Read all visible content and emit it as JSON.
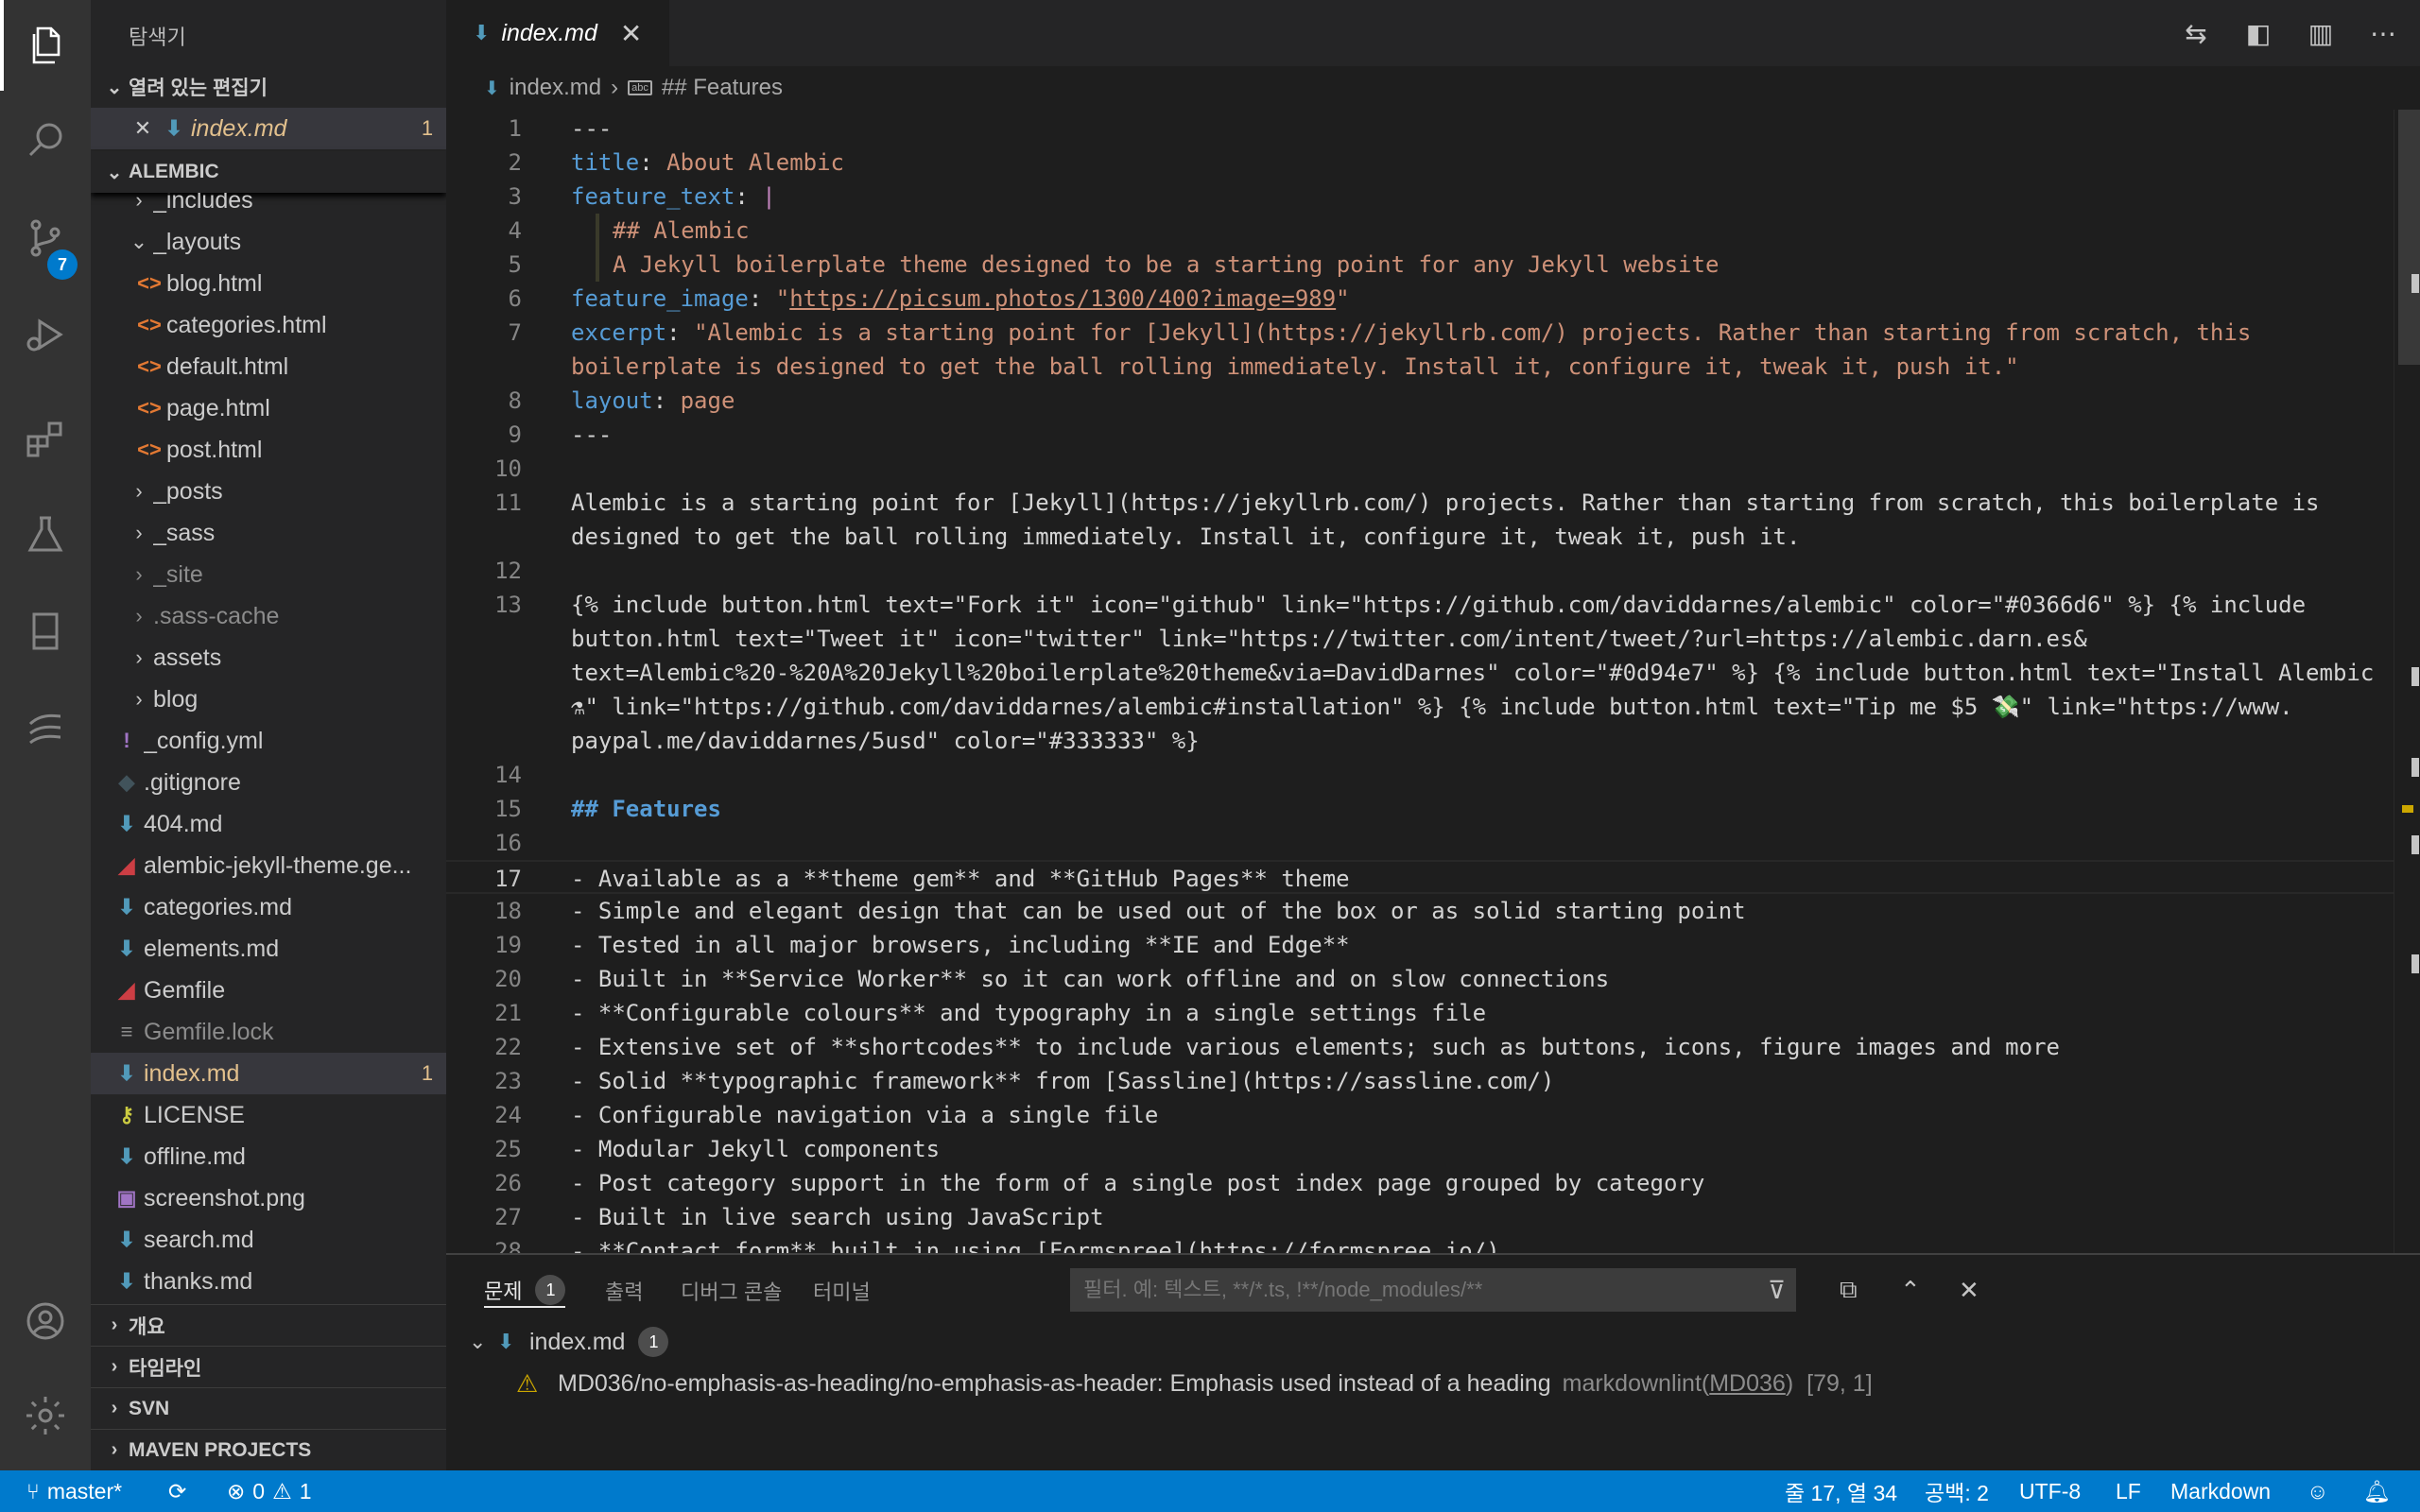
{
  "activity_bar": {
    "source_control_badge": "7"
  },
  "sidebar": {
    "title": "탐색기",
    "open_editors": {
      "header": "열려 있는 편집기",
      "items": [
        {
          "name": "index.md",
          "count": "1"
        }
      ]
    },
    "project": {
      "header": "ALEMBIC",
      "items": [
        {
          "name": "_includes"
        },
        {
          "name": "_layouts"
        },
        {
          "name": "blog.html"
        },
        {
          "name": "categories.html"
        },
        {
          "name": "default.html"
        },
        {
          "name": "page.html"
        },
        {
          "name": "post.html"
        },
        {
          "name": "_posts"
        },
        {
          "name": "_sass"
        },
        {
          "name": "_site"
        },
        {
          "name": ".sass-cache"
        },
        {
          "name": "assets"
        },
        {
          "name": "blog"
        },
        {
          "name": "_config.yml"
        },
        {
          "name": ".gitignore"
        },
        {
          "name": "404.md"
        },
        {
          "name": "alembic-jekyll-theme.ge..."
        },
        {
          "name": "categories.md"
        },
        {
          "name": "elements.md"
        },
        {
          "name": "Gemfile"
        },
        {
          "name": "Gemfile.lock"
        },
        {
          "name": "index.md",
          "count": "1"
        },
        {
          "name": "LICENSE"
        },
        {
          "name": "offline.md"
        },
        {
          "name": "screenshot.png"
        },
        {
          "name": "search.md"
        },
        {
          "name": "thanks.md"
        }
      ]
    },
    "bottom_sections": [
      "개요",
      "타임라인",
      "SVN",
      "MAVEN PROJECTS"
    ]
  },
  "editor": {
    "tab_label": "index.md",
    "breadcrumb": {
      "file": "index.md",
      "symbol": "## Features",
      "symbol_icon": "abc"
    },
    "lines": [
      {
        "n": "1",
        "t": "---"
      },
      {
        "n": "2",
        "k": "title",
        "t": "About Alembic"
      },
      {
        "n": "3",
        "k": "feature_text",
        "t": "|"
      },
      {
        "n": "4",
        "t": "## Alembic"
      },
      {
        "n": "5",
        "t": "A Jekyll boilerplate theme designed to be a starting point for any Jekyll website"
      },
      {
        "n": "6",
        "k": "feature_image",
        "t": "https://picsum.photos/1300/400?image=989"
      },
      {
        "n": "7",
        "k": "excerpt",
        "t": "\"Alembic is a starting point for [Jekyll](https://jekyllrb.com/) projects. Rather than starting from scratch, this"
      },
      {
        "n": "",
        "t": "boilerplate is designed to get the ball rolling immediately. Install it, configure it, tweak it, push it.\""
      },
      {
        "n": "8",
        "k": "layout",
        "t": "page"
      },
      {
        "n": "9",
        "t": "---"
      },
      {
        "n": "10",
        "t": ""
      },
      {
        "n": "11",
        "t": "Alembic is a starting point for [Jekyll](https://jekyllrb.com/) projects. Rather than starting from scratch, this boilerplate is"
      },
      {
        "n": "",
        "t": "designed to get the ball rolling immediately. Install it, configure it, tweak it, push it."
      },
      {
        "n": "12",
        "t": ""
      },
      {
        "n": "13",
        "t": "{% include button.html text=\"Fork it\" icon=\"github\" link=\"https://github.com/daviddarnes/alembic\" color=\"#0366d6\" %} {% include"
      },
      {
        "n": "",
        "t": "button.html text=\"Tweet it\" icon=\"twitter\" link=\"https://twitter.com/intent/tweet/?url=https://alembic.darn.es&"
      },
      {
        "n": "",
        "t": "text=Alembic%20-%20A%20Jekyll%20boilerplate%20theme&via=DavidDarnes\" color=\"#0d94e7\" %} {% include button.html text=\"Install Alembic"
      },
      {
        "n": "",
        "t": "⚗\" link=\"https://github.com/daviddarnes/alembic#installation\" %} {% include button.html text=\"Tip me $5 💸\" link=\"https://www."
      },
      {
        "n": "",
        "t": "paypal.me/daviddarnes/5usd\" color=\"#333333\" %}"
      },
      {
        "n": "14",
        "t": ""
      },
      {
        "n": "15",
        "t": "## Features"
      },
      {
        "n": "16",
        "t": ""
      },
      {
        "n": "17",
        "t": "- Available as a **theme gem** and **GitHub Pages** theme"
      },
      {
        "n": "18",
        "t": "- Simple and elegant design that can be used out of the box or as solid starting point"
      },
      {
        "n": "19",
        "t": "- Tested in all major browsers, including **IE and Edge**"
      },
      {
        "n": "20",
        "t": "- Built in **Service Worker** so it can work offline and on slow connections"
      },
      {
        "n": "21",
        "t": "- **Configurable colours** and typography in a single settings file"
      },
      {
        "n": "22",
        "t": "- Extensive set of **shortcodes** to include various elements; such as buttons, icons, figure images and more"
      },
      {
        "n": "23",
        "t": "- Solid **typographic framework** from [Sassline](https://sassline.com/)"
      },
      {
        "n": "24",
        "t": "- Configurable navigation via a single file"
      },
      {
        "n": "25",
        "t": "- Modular Jekyll components"
      },
      {
        "n": "26",
        "t": "- Post category support in the form of a single post index page grouped by category"
      },
      {
        "n": "27",
        "t": "- Built in live search using JavaScript"
      },
      {
        "n": "28",
        "t": "- **Contact form** built in using [Formspree](https://formspree.io/)"
      }
    ]
  },
  "panel": {
    "tabs": [
      {
        "label": "문제",
        "badge": "1"
      },
      {
        "label": "출력"
      },
      {
        "label": "디버그 콘솔"
      },
      {
        "label": "터미널"
      }
    ],
    "filter_placeholder": "필터. 예: 텍스트, **/*.ts, !**/node_modules/**",
    "file": {
      "name": "index.md",
      "count": "1"
    },
    "problem": {
      "message": "MD036/no-emphasis-as-heading/no-emphasis-as-header: Emphasis used instead of a heading",
      "source": "markdownlint(",
      "code": "MD036",
      "source_end": ")",
      "position": "[79, 1]"
    }
  },
  "status_bar": {
    "branch": "master*",
    "errors": "0",
    "warnings": "1",
    "cursor": "줄 17, 열 34",
    "indent": "공백: 2",
    "encoding": "UTF-8",
    "eol": "LF",
    "language": "Markdown"
  },
  "colors": {
    "accent": "#007acc",
    "markdown_icon": "#519aba",
    "modified": "#e2c08d",
    "warning": "#cca700"
  }
}
